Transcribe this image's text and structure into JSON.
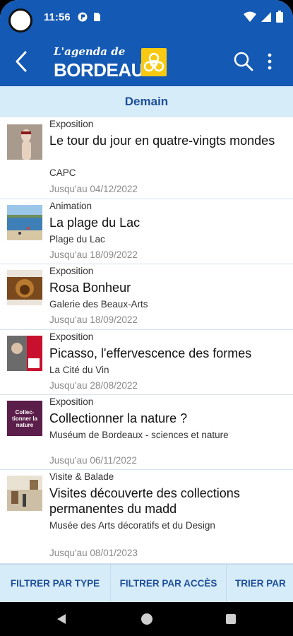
{
  "status_bar": {
    "time": "11:56"
  },
  "app_bar": {
    "logo_line1": "L'agenda de",
    "logo_line2": "BORDEAUX"
  },
  "section": {
    "title": "Demain"
  },
  "events": [
    {
      "category": "Exposition",
      "title": "Le tour du jour en quatre-vingts mondes",
      "place": "CAPC",
      "until": "Jusqu'au 04/12/2022"
    },
    {
      "category": "Animation",
      "title": "La plage du Lac",
      "place": "Plage du Lac",
      "until": "Jusqu'au 18/09/2022"
    },
    {
      "category": "Exposition",
      "title": "Rosa Bonheur",
      "place": "Galerie des Beaux-Arts",
      "until": "Jusqu'au 18/09/2022"
    },
    {
      "category": "Exposition",
      "title": "Picasso, l'effervescence des formes",
      "place": "La Cité du Vin",
      "until": "Jusqu'au 28/08/2022"
    },
    {
      "category": "Exposition",
      "title": "Collectionner la nature ?",
      "place": "Muséum de Bordeaux - sciences et nature",
      "until": "Jusqu'au 06/11/2022",
      "thumb_text": "Collec-tionner la nature"
    },
    {
      "category": "Visite & Balade",
      "title": "Visites découverte des collections permanentes du madd",
      "place": "Musée des Arts décoratifs et du Design",
      "until": "Jusqu'au 08/01/2023"
    }
  ],
  "filters": {
    "by_type": "FILTRER PAR TYPE",
    "by_access": "FILTRER PAR ACCÈS",
    "sort": "TRIER PAR"
  },
  "colors": {
    "primary": "#1459b4",
    "section_bg": "#d7ecf9",
    "section_text": "#1d4f9a",
    "badge": "#f7c911"
  }
}
